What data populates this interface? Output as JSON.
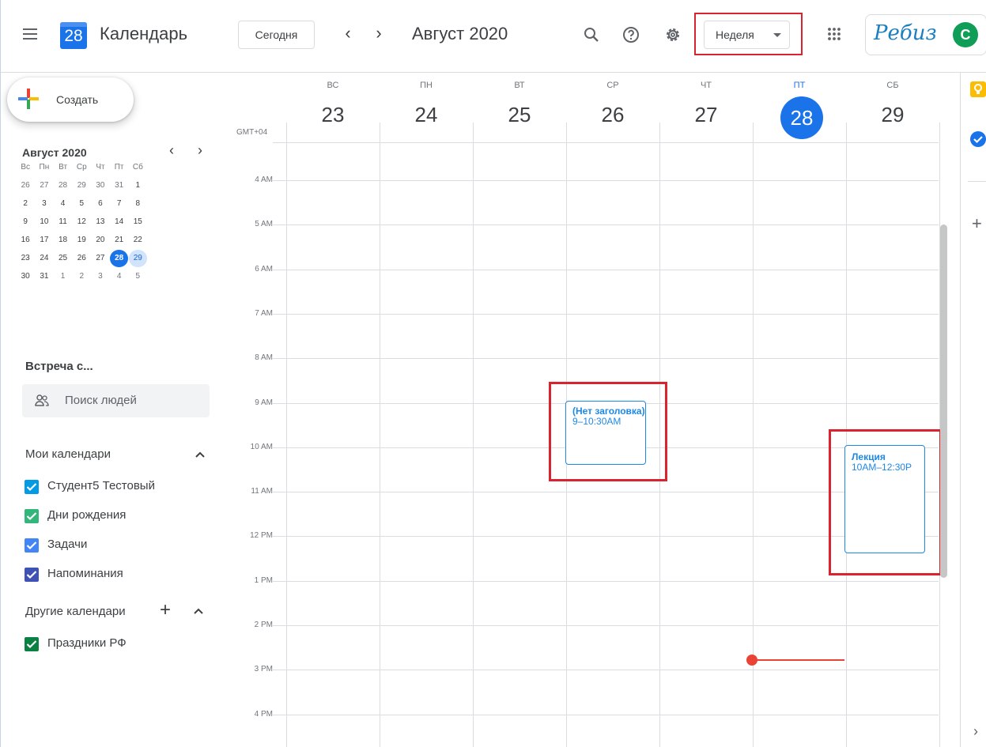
{
  "header": {
    "app_logo_day": "28",
    "app_title": "Календарь",
    "today_button": "Сегодня",
    "month_title": "Август 2020",
    "view_selector": "Неделя",
    "brand_logo": "Ребиз",
    "avatar_initial": "C"
  },
  "sidebar": {
    "create_label": "Создать",
    "mini_calendar": {
      "title": "Август 2020",
      "weekdays": [
        "Вс",
        "Пн",
        "Вт",
        "Ср",
        "Чт",
        "Пт",
        "Сб"
      ],
      "weeks": [
        [
          "26",
          "27",
          "28",
          "29",
          "30",
          "31",
          "1"
        ],
        [
          "2",
          "3",
          "4",
          "5",
          "6",
          "7",
          "8"
        ],
        [
          "9",
          "10",
          "11",
          "12",
          "13",
          "14",
          "15"
        ],
        [
          "16",
          "17",
          "18",
          "19",
          "20",
          "21",
          "22"
        ],
        [
          "23",
          "24",
          "25",
          "26",
          "27",
          "28",
          "29"
        ],
        [
          "30",
          "31",
          "1",
          "2",
          "3",
          "4",
          "5"
        ]
      ],
      "today": "28",
      "selected": "29"
    },
    "meet_title": "Встреча с...",
    "search_people_placeholder": "Поиск людей",
    "my_calendars_title": "Мои календари",
    "my_calendars": [
      {
        "label": "Студент5 Тестовый",
        "color": "#039be5"
      },
      {
        "label": "Дни рождения",
        "color": "#33b679"
      },
      {
        "label": "Задачи",
        "color": "#4285f4"
      },
      {
        "label": "Напоминания",
        "color": "#3f51b5"
      }
    ],
    "other_calendars_title": "Другие календари",
    "other_calendars": [
      {
        "label": "Праздники РФ",
        "color": "#0b8043"
      }
    ]
  },
  "week": {
    "timezone": "GMT+04",
    "days": [
      {
        "dow": "ВС",
        "num": "23"
      },
      {
        "dow": "ПН",
        "num": "24"
      },
      {
        "dow": "ВТ",
        "num": "25"
      },
      {
        "dow": "СР",
        "num": "26"
      },
      {
        "dow": "ЧТ",
        "num": "27"
      },
      {
        "dow": "ПТ",
        "num": "28",
        "today": true
      },
      {
        "dow": "СБ",
        "num": "29"
      }
    ],
    "hours": [
      "4 AM",
      "5 AM",
      "6 AM",
      "7 AM",
      "8 AM",
      "9 AM",
      "10 AM",
      "11 AM",
      "12 PM",
      "1 PM",
      "2 PM",
      "3 PM",
      "4 PM"
    ]
  },
  "events": [
    {
      "title": "(Нет заголовка)",
      "time": "9–10:30AM"
    },
    {
      "title": "Лекция",
      "time": "10AM–12:30P"
    }
  ],
  "colors": {
    "accent": "#1a73e8",
    "highlight": "#d9232e",
    "now_line": "#ea4335"
  }
}
